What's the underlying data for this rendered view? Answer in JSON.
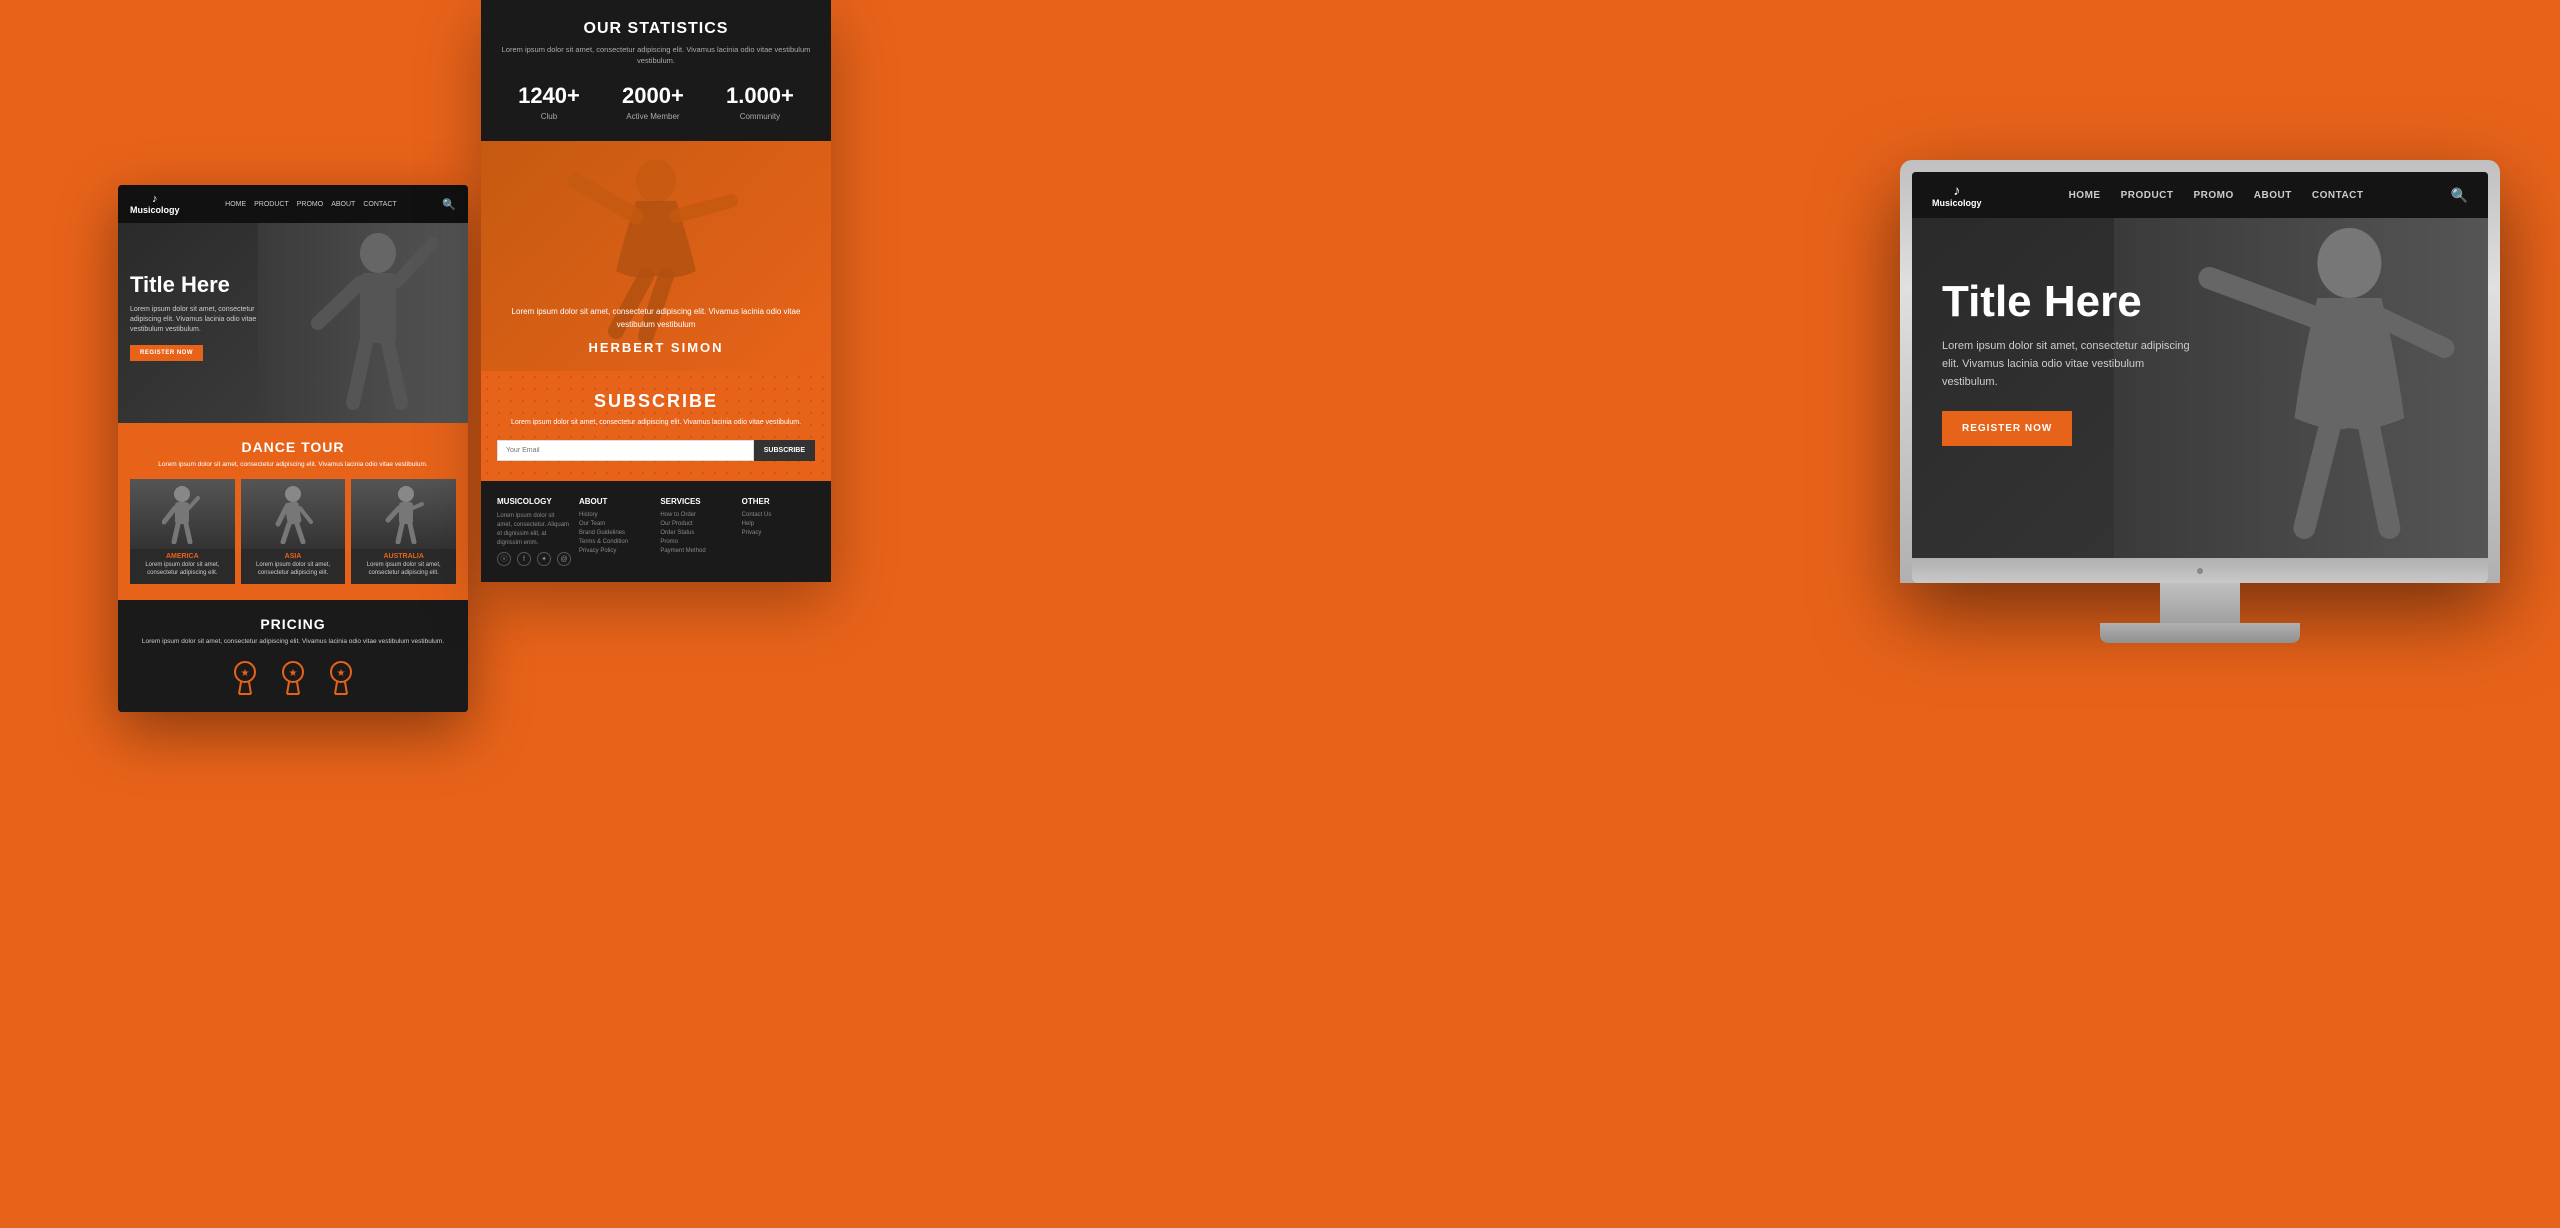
{
  "background_color": "#e8631a",
  "left_mobile": {
    "nav": {
      "logo_text": "Musicology",
      "links": [
        "HOME",
        "PRODUCT",
        "PROMO",
        "ABOUT",
        "CONTACT"
      ],
      "music_note": "♪"
    },
    "hero": {
      "title": "Title Here",
      "description": "Lorem ipsum dolor sit amet, consectetur adipiscing elit. Vivamus lacinia odio vitae vestibulum vestibulum.",
      "cta_label": "REGISTER NOW"
    },
    "dance_tour": {
      "section_title": "DANCE TOUR",
      "section_desc": "Lorem ipsum dolor sit amet, consectetur adipiscing elit. Vivamus lacinia odio vitae vestibulum.",
      "cards": [
        {
          "label": "AMERICA",
          "desc": "Lorem ipsum dolor sit amet, consectetur adipiscing elit."
        },
        {
          "label": "ASIA",
          "desc": "Lorem ipsum dolor sit amet, consectetur adipiscing elit."
        },
        {
          "label": "AUSTRALIA",
          "desc": "Lorem ipsum dolor sit amet, consectetur adipiscing elit."
        }
      ]
    },
    "pricing": {
      "section_title": "PRICING",
      "section_desc": "Lorem ipsum dolor sit amet, consectetur adipiscing elit. Vivamus lacinia odio vitae vestibulum vestibulum.",
      "icons": [
        "🏅",
        "🏅",
        "🏅"
      ]
    }
  },
  "center_tablet": {
    "stats": {
      "section_title": "OUR STATISTICS",
      "section_desc": "Lorem ipsum dolor sit amet, consectetur adipiscing elit.\nVivamus lacinia odio vitae vestibulum vestibulum.",
      "items": [
        {
          "number": "1240+",
          "label": "Club"
        },
        {
          "number": "2000+",
          "label": "Active Member"
        },
        {
          "number": "1.000+",
          "label": "Community"
        }
      ]
    },
    "artist": {
      "description": "Lorem ipsum dolor sit amet, consectetur\nadipiscing elit. Vivamus lacinia odio vitae\nvestibulum vestibulum",
      "name": "HERBERT SIMON"
    },
    "subscribe": {
      "section_title": "SUBSCRIBE",
      "section_desc": "Lorem ipsum dolor sit amet, consectetur adipiscing elit. Vivamus lacinia odio vitae vestibulum.",
      "input_placeholder": "Your Email",
      "button_label": "SUBSCRIBE"
    },
    "footer": {
      "col1_title": "MUSICOLOGY",
      "col1_text": "Lorem ipsum dolor sit amet, consectetur. Aliquam et dignissim elit, at dignissim enim.",
      "col2_title": "ABOUT",
      "col2_links": [
        "History",
        "Our Team",
        "Brand Guidelines",
        "Terms & Condition",
        "Privacy Policy"
      ],
      "col3_title": "SERVICES",
      "col3_links": [
        "How to Order",
        "Our Product",
        "Order Status",
        "Promo",
        "Payment Method"
      ],
      "col4_title": "OTHER",
      "col4_links": [
        "Contact Us",
        "Help",
        "Privacy"
      ],
      "socials": [
        "ⓢ",
        "f",
        "✦",
        "@"
      ]
    }
  },
  "right_desktop": {
    "nav": {
      "logo_text": "Musicology",
      "music_note": "♪",
      "links": [
        "HOME",
        "PRODUCT",
        "PROMO",
        "ABOUT",
        "CONTACT"
      ]
    },
    "hero": {
      "title": "Title Here",
      "description": "Lorem ipsum dolor sit amet, consectetur adipiscing elit. Vivamus lacinia odio vitae vestibulum vestibulum.",
      "cta_label": "REGISTER NOW"
    }
  }
}
